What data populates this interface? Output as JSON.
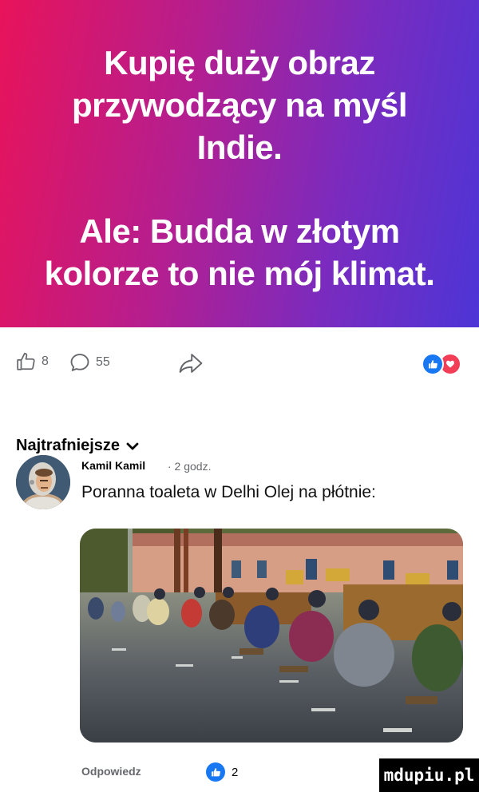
{
  "post": {
    "line1": "Kupię duży obraz",
    "line2": "przywodzący na myśl",
    "line3": "Indie.",
    "line4": "Ale: Budda w złotym",
    "line5": "kolorze to nie mój klimat."
  },
  "actions": {
    "likes": "8",
    "comments": "55",
    "like_icon": "thumbs-up-icon",
    "comment_icon": "speech-bubble-icon",
    "share_icon": "share-arrow-icon",
    "reaction_icons": [
      "like-reaction-icon",
      "love-reaction-icon"
    ]
  },
  "comments_sort": {
    "label": "Najtrafniejsze"
  },
  "comment": {
    "author": "Kamil Kamil",
    "time": "· 2 godz.",
    "text": "Poranna toaleta w Delhi Olej na płótnie:",
    "reply_label": "Odpowiedz",
    "likes": "2"
  },
  "watermark": "mdupiu.pl",
  "colors": {
    "gradient_start": "#e8135a",
    "gradient_end": "#4d35d6",
    "facebook_blue": "#1877f2",
    "love_red": "#f33e58",
    "muted_text": "#65676b"
  }
}
